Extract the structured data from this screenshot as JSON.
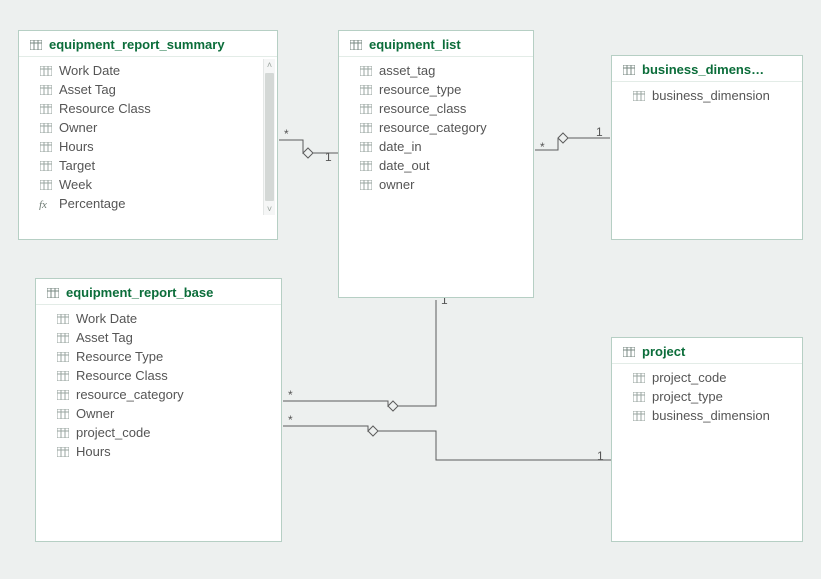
{
  "tables": {
    "summary": {
      "title": "equipment_report_summary",
      "fields": [
        {
          "label": "Work Date",
          "icon": "col"
        },
        {
          "label": "Asset Tag",
          "icon": "col"
        },
        {
          "label": "Resource Class",
          "icon": "col"
        },
        {
          "label": "Owner",
          "icon": "col"
        },
        {
          "label": "Hours",
          "icon": "col"
        },
        {
          "label": "Target",
          "icon": "col"
        },
        {
          "label": "Week",
          "icon": "col"
        },
        {
          "label": "Percentage",
          "icon": "fx"
        }
      ]
    },
    "list": {
      "title": "equipment_list",
      "fields": [
        {
          "label": "asset_tag",
          "icon": "col"
        },
        {
          "label": "resource_type",
          "icon": "col"
        },
        {
          "label": "resource_class",
          "icon": "col"
        },
        {
          "label": "resource_category",
          "icon": "col"
        },
        {
          "label": "date_in",
          "icon": "col"
        },
        {
          "label": "date_out",
          "icon": "col"
        },
        {
          "label": "owner",
          "icon": "col"
        }
      ]
    },
    "bdim": {
      "title": "business_dimens…",
      "fields": [
        {
          "label": "business_dimension",
          "icon": "col"
        }
      ]
    },
    "base": {
      "title": "equipment_report_base",
      "fields": [
        {
          "label": "Work Date",
          "icon": "col"
        },
        {
          "label": "Asset Tag",
          "icon": "col"
        },
        {
          "label": "Resource Type",
          "icon": "col"
        },
        {
          "label": "Resource Class",
          "icon": "col"
        },
        {
          "label": "resource_category",
          "icon": "col"
        },
        {
          "label": "Owner",
          "icon": "col"
        },
        {
          "label": "project_code",
          "icon": "col"
        },
        {
          "label": "Hours",
          "icon": "col"
        }
      ]
    },
    "project": {
      "title": "project",
      "fields": [
        {
          "label": "project_code",
          "icon": "col"
        },
        {
          "label": "project_type",
          "icon": "col"
        },
        {
          "label": "business_dimension",
          "icon": "col"
        }
      ]
    }
  },
  "relationships": [
    {
      "from": "summary",
      "to": "list",
      "from_card": "*",
      "to_card": "1"
    },
    {
      "from": "list",
      "to": "bdim",
      "from_card": "*",
      "to_card": "1"
    },
    {
      "from": "base",
      "to": "list",
      "from_card": "*",
      "to_card": "1"
    },
    {
      "from": "base",
      "to": "project",
      "from_card": "*",
      "to_card": "1"
    }
  ]
}
